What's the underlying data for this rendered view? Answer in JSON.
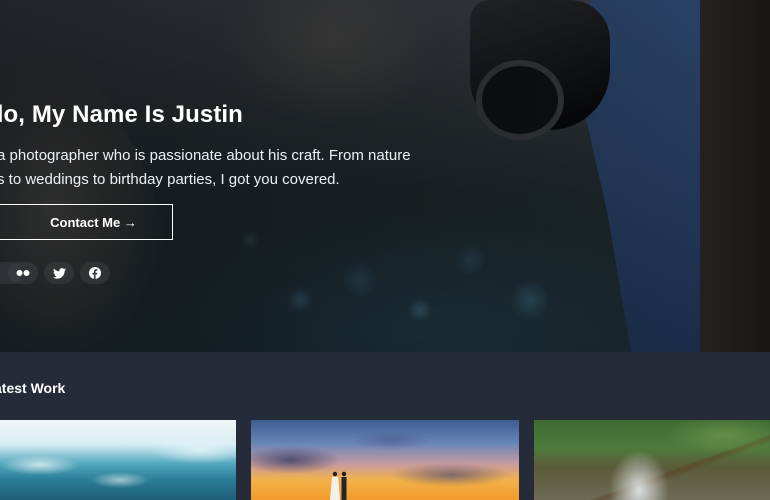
{
  "hero": {
    "title": "llo, My Name Is Justin",
    "line1": "a photographer who is passionate about his craft. From nature",
    "line2": "s to weddings to birthday parties, I got you covered.",
    "contact_label": "Contact Me →"
  },
  "social": [
    {
      "icon": "partial-icon"
    },
    {
      "icon": "flickr-icon"
    },
    {
      "icon": "twitter-icon"
    },
    {
      "icon": "facebook-icon"
    }
  ],
  "work": {
    "title": "atest Work"
  },
  "colors": {
    "page_bg": "#252b38",
    "text": "#ffffff"
  }
}
